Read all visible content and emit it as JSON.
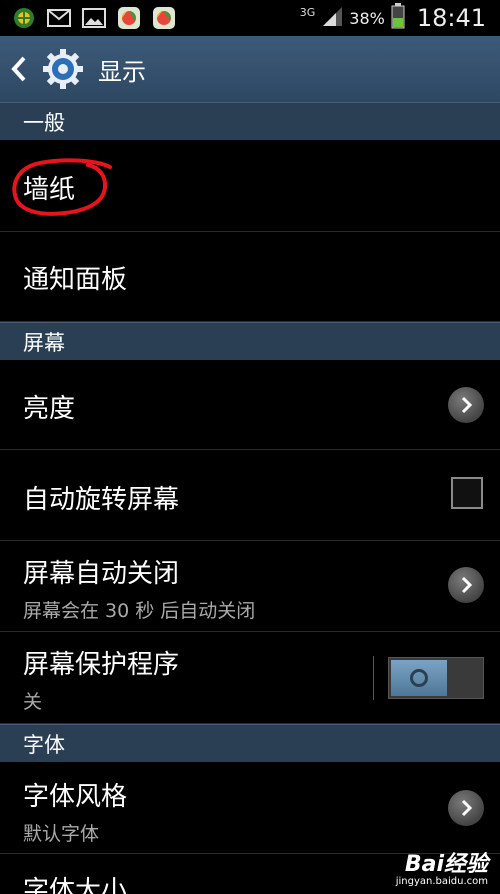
{
  "status_bar": {
    "network": "3G",
    "battery": "38%",
    "time": "18:41"
  },
  "action_bar": {
    "title": "显示"
  },
  "sections": {
    "general": "一般",
    "screen": "屏幕",
    "font": "字体"
  },
  "items": {
    "wallpaper": "墙纸",
    "notification_panel": "通知面板",
    "brightness": "亮度",
    "auto_rotate": "自动旋转屏幕",
    "screen_timeout": "屏幕自动关闭",
    "screen_timeout_sub": "屏幕会在 30 秒 后自动关闭",
    "screensaver": "屏幕保护程序",
    "screensaver_sub": "关",
    "font_style": "字体风格",
    "font_style_sub": "默认字体",
    "font_size": "字体大小"
  },
  "states": {
    "auto_rotate_checked": false,
    "screensaver_on": false
  },
  "colors": {
    "annotation": "#e8141c",
    "section_bg": "#2b3f54",
    "action_bar_bg": "#3c5a78"
  },
  "watermark": {
    "main": "Bai经验",
    "sub": "jingyan.baidu.com"
  }
}
